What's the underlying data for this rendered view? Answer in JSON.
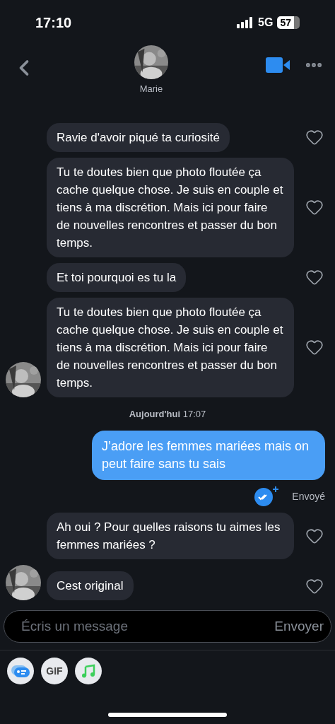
{
  "status_bar": {
    "time": "17:10",
    "network": "5G",
    "battery": "57"
  },
  "header": {
    "name": "Marie"
  },
  "messages": [
    {
      "kind": "incoming",
      "text": "Ravie d'avoir piqué ta curiosité",
      "avatar": false,
      "liked": false
    },
    {
      "kind": "incoming",
      "text": "Tu te doutes bien que photo floutée ça cache quelque chose. Je suis en couple et tiens à ma discrétion. Mais ici pour faire de nouvelles rencontres et passer du bon temps.",
      "avatar": false,
      "liked": false
    },
    {
      "kind": "incoming",
      "text": "Et toi pourquoi es tu la",
      "avatar": false,
      "liked": false
    },
    {
      "kind": "incoming",
      "text": "Tu te doutes bien que photo floutée ça cache quelque chose. Je suis en couple et tiens à ma discrétion. Mais ici pour faire de nouvelles rencontres et passer du bon temps.",
      "avatar": true,
      "liked": false
    },
    {
      "kind": "date",
      "text": "**Aujourd'hui** 17:07"
    },
    {
      "kind": "outgoing",
      "text": "J’adore les femmes mariées mais on peut faire sans tu sais",
      "status": "Envoyé"
    },
    {
      "kind": "incoming",
      "text": "Ah oui ? Pour quelles raisons tu aimes les femmes mariées ?",
      "avatar": false,
      "liked": false
    },
    {
      "kind": "incoming",
      "text": "Cest original",
      "avatar": true,
      "liked": false
    }
  ],
  "composer": {
    "placeholder": "Écris un message",
    "send": "Envoyer"
  },
  "attachments": [
    {
      "kind": "card"
    },
    {
      "kind": "gif",
      "label": "GIF"
    },
    {
      "kind": "music"
    }
  ]
}
